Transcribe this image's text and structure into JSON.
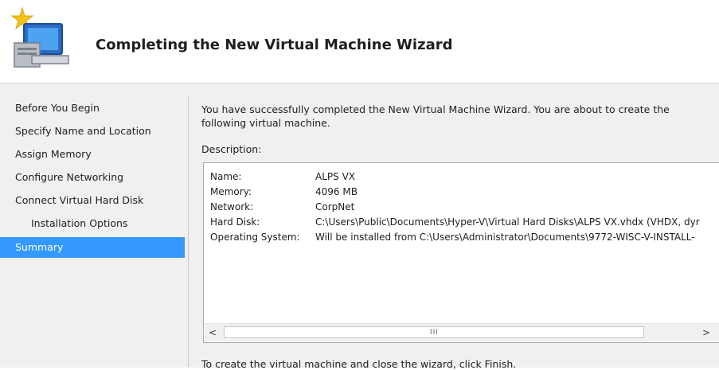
{
  "header": {
    "title": "Completing the New Virtual Machine Wizard"
  },
  "icons": {
    "wizard": "computer-with-star-icon"
  },
  "colors": {
    "selection": "#3399ff",
    "sidebar_bg": "#f0f0f0",
    "box_border": "#a9a9a9"
  },
  "sidebar": {
    "items": [
      {
        "label": "Before You Begin",
        "selected": false
      },
      {
        "label": "Specify Name and Location",
        "selected": false
      },
      {
        "label": "Assign Memory",
        "selected": false
      },
      {
        "label": "Configure Networking",
        "selected": false
      },
      {
        "label": "Connect Virtual Hard Disk",
        "selected": false
      },
      {
        "label": "Installation Options",
        "selected": false,
        "sub_item": true
      },
      {
        "label": "Summary",
        "selected": true
      }
    ]
  },
  "main": {
    "intro": "You have successfully completed the New Virtual Machine Wizard. You are about to create the following virtual machine.",
    "description_label": "Description:",
    "description": {
      "rows": [
        {
          "key": "Name:",
          "value": "ALPS VX"
        },
        {
          "key": "Memory:",
          "value": "4096 MB"
        },
        {
          "key": "Network:",
          "value": "CorpNet"
        },
        {
          "key": "Hard Disk:",
          "value": "C:\\Users\\Public\\Documents\\Hyper-V\\Virtual Hard Disks\\ALPS VX.vhdx (VHDX, dyr"
        },
        {
          "key": "Operating System:",
          "value": "Will be installed from C:\\Users\\Administrator\\Documents\\9772-WISC-V-INSTALL-"
        }
      ]
    },
    "scrollbar": {
      "left_arrow": "<",
      "right_arrow": ">",
      "grip": "III"
    },
    "footer": "To create the virtual machine and close the wizard, click Finish."
  }
}
